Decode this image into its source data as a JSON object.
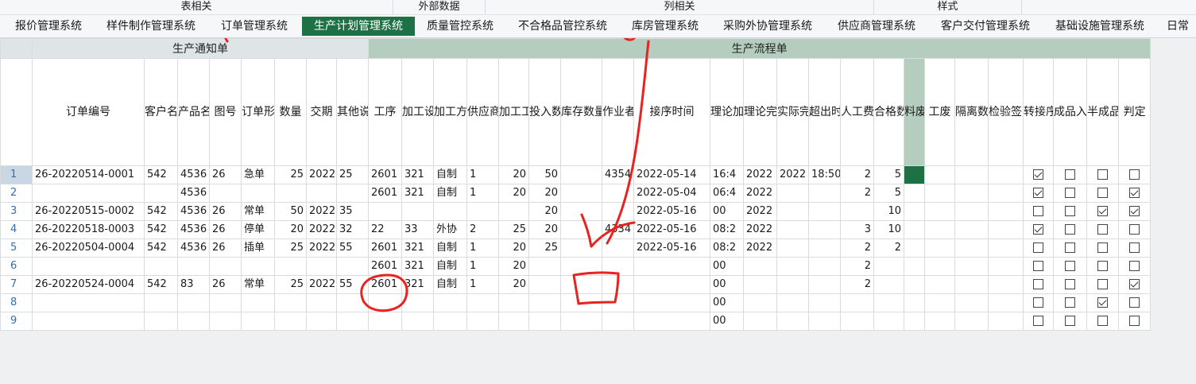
{
  "ribbon_groups": [
    "表相关",
    "外部数据",
    "列相关",
    "样式"
  ],
  "tabs": [
    {
      "label": "报价管理系统",
      "active": false
    },
    {
      "label": "样件制作管理系统",
      "active": false
    },
    {
      "label": "订单管理系统",
      "active": false
    },
    {
      "label": "生产计划管理系统",
      "active": true
    },
    {
      "label": "质量管控系统",
      "active": false
    },
    {
      "label": "不合格品管控系统",
      "active": false
    },
    {
      "label": "库房管理系统",
      "active": false
    },
    {
      "label": "采购外协管理系统",
      "active": false
    },
    {
      "label": "供应商管理系统",
      "active": false
    },
    {
      "label": "客户交付管理系统",
      "active": false
    },
    {
      "label": "基础设施管理系统",
      "active": false
    },
    {
      "label": "日常",
      "active": false
    }
  ],
  "sections": {
    "notice": "生产通知单",
    "flow": "生产流程单"
  },
  "columns": [
    "订单编号",
    "客户名称",
    "产品名称",
    "图号",
    "订单形式",
    "数量",
    "交期",
    "其他说明",
    "工序",
    "加工设备",
    "加工方式",
    "供应商",
    "加工工时",
    "投入数",
    "库存数量",
    "作业者",
    "接序时间",
    "理论加工耗时",
    "理论完成时间",
    "实际完工时间",
    "超出时间",
    "人工费",
    "合格数",
    "料废",
    "工废",
    "隔离数",
    "检验签名",
    "转接序发送",
    "成品入库",
    "半成品入库",
    "判定"
  ],
  "rows": [
    {
      "n": "1",
      "cells": [
        "26-20220514-0001",
        "542",
        "4536",
        "26",
        "急单",
        "25",
        "2022",
        "25",
        "2601",
        "321",
        "自制",
        "1",
        "20",
        "50",
        "",
        "4354",
        "2022-05-14",
        "16:4",
        "2022",
        "2022",
        "18:50",
        "2",
        "5",
        "",
        "",
        "",
        "",
        true,
        false,
        false,
        false
      ]
    },
    {
      "n": "2",
      "cells": [
        "",
        "",
        "4536",
        "",
        "",
        "",
        "",
        "",
        "2601",
        "321",
        "自制",
        "1",
        "20",
        "20",
        "",
        "",
        "2022-05-04",
        "06:4",
        "2022",
        "",
        "",
        "2",
        "5",
        "",
        "",
        "",
        "",
        true,
        false,
        false,
        true
      ]
    },
    {
      "n": "3",
      "cells": [
        "26-20220515-0002",
        "542",
        "4536",
        "26",
        "常单",
        "50",
        "2022",
        "35",
        "",
        "",
        "",
        "",
        "",
        "20",
        "",
        "",
        "2022-05-16",
        "00",
        "2022",
        "",
        "",
        "",
        "10",
        "",
        "",
        "",
        "",
        false,
        false,
        true,
        true
      ]
    },
    {
      "n": "4",
      "cells": [
        "26-20220518-0003",
        "542",
        "4536",
        "26",
        "停单",
        "20",
        "2022",
        "32",
        "22",
        "33",
        "外协",
        "2",
        "25",
        "20",
        "",
        "4334",
        "2022-05-16",
        "08:2",
        "2022",
        "",
        "",
        "3",
        "10",
        "",
        "",
        "",
        "",
        true,
        false,
        false,
        false
      ]
    },
    {
      "n": "5",
      "cells": [
        "26-20220504-0004",
        "542",
        "4536",
        "26",
        "插单",
        "25",
        "2022",
        "55",
        "2601",
        "321",
        "自制",
        "1",
        "20",
        "25",
        "",
        "",
        "2022-05-16",
        "08:2",
        "2022",
        "",
        "",
        "2",
        "2",
        "",
        "",
        "",
        "",
        false,
        false,
        false,
        false
      ]
    },
    {
      "n": "6",
      "cells": [
        "",
        "",
        "",
        "",
        "",
        "",
        "",
        "",
        "2601",
        "321",
        "自制",
        "1",
        "20",
        "",
        "",
        "",
        "",
        "00",
        "",
        "",
        "",
        "2",
        "",
        "",
        "",
        "",
        "",
        false,
        false,
        false,
        false
      ]
    },
    {
      "n": "7",
      "cells": [
        "26-20220524-0004",
        "542",
        "83",
        "26",
        "常单",
        "25",
        "2022",
        "55",
        "2601",
        "321",
        "自制",
        "1",
        "20",
        "",
        "",
        "",
        "",
        "00",
        "",
        "",
        "",
        "2",
        "",
        "",
        "",
        "",
        "",
        false,
        false,
        false,
        true
      ]
    },
    {
      "n": "8",
      "cells": [
        "",
        "",
        "",
        "",
        "",
        "",
        "",
        "",
        "",
        "",
        "",
        "",
        "",
        "",
        "",
        "",
        "",
        "00",
        "",
        "",
        "",
        "",
        "",
        "",
        "",
        "",
        "",
        false,
        false,
        true,
        false
      ]
    },
    {
      "n": "9",
      "cells": [
        "",
        "",
        "",
        "",
        "",
        "",
        "",
        "",
        "",
        "",
        "",
        "",
        "",
        "",
        "",
        "",
        "",
        "00",
        "",
        "",
        "",
        "",
        "",
        "",
        "",
        "",
        "",
        false,
        false,
        false,
        false
      ]
    }
  ],
  "colors": {
    "accent": "#1e7145",
    "section_flow": "#b5cdbf",
    "annotation": "#e8231f"
  }
}
